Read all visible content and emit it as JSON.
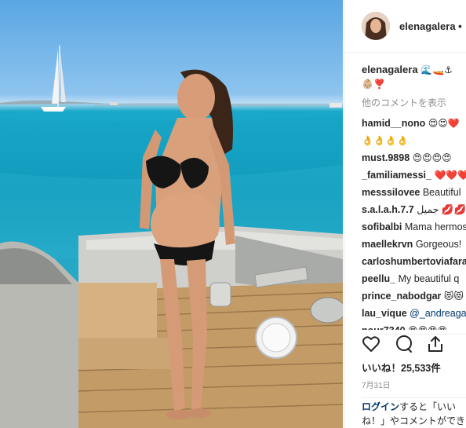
{
  "post": {
    "username": "elenagalera",
    "follow_dot": "•",
    "caption_user": "elenagalera",
    "caption_text": "🌊🚤⚓👶🏼❣️",
    "more_comments": "他のコメントを表示",
    "comments": [
      {
        "user": "hamid__nono",
        "text": "😍😍❤️"
      },
      {
        "user": "",
        "text": "👌👌👌👌"
      },
      {
        "user": "must.9898",
        "text": "😍😍😍😍"
      },
      {
        "user": "_familiamessi_",
        "text": "❤️❤️❤️"
      },
      {
        "user": "messsilovee",
        "text": "Beautiful"
      },
      {
        "user": "s.a.l.a.h.7.7",
        "text": "جميل 💋💋"
      },
      {
        "user": "sofibalbi",
        "text": "Mama hermosa"
      },
      {
        "user": "maellekrvn",
        "text": "Gorgeous!"
      },
      {
        "user": "carloshumbertoviafara",
        "text": ""
      },
      {
        "user": "peellu_",
        "text": "My beautiful q"
      },
      {
        "user": "prince_nabodgar",
        "text": "😻😻"
      },
      {
        "user": "lau_vique",
        "text": "@_andreagal",
        "mention": true
      },
      {
        "user": "nour7340",
        "text": "😍😍😍😍"
      }
    ],
    "likes": "いいね！25,533件",
    "date": "7月31日",
    "login_link": "ログイン",
    "login_text": "すると「いいね！」やコメントができます。"
  },
  "icons": [
    "heart-icon",
    "comment-icon",
    "share-icon"
  ],
  "colors": {
    "link": "#003569",
    "muted": "#8e8e8e",
    "text": "#262626",
    "sea": "#1aa9c9"
  }
}
